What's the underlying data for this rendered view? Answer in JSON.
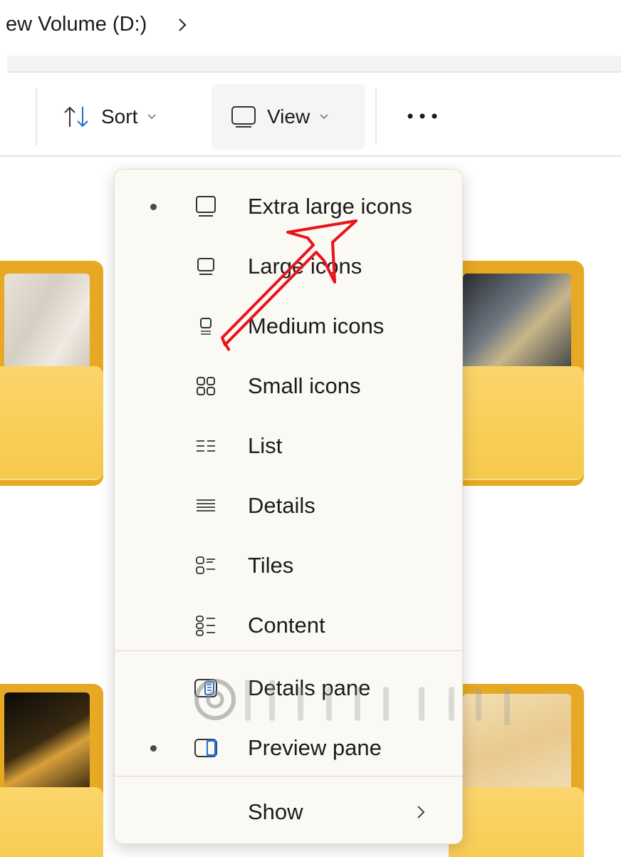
{
  "breadcrumb": {
    "current": "ew Volume (D:)"
  },
  "toolbar": {
    "sort_label": "Sort",
    "view_label": "View"
  },
  "view_menu": {
    "items": [
      {
        "label": "Extra large icons",
        "icon": "extra-large-icons-icon",
        "selected": true
      },
      {
        "label": "Large icons",
        "icon": "large-icons-icon",
        "selected": false
      },
      {
        "label": "Medium icons",
        "icon": "medium-icons-icon",
        "selected": false
      },
      {
        "label": "Small icons",
        "icon": "small-icons-icon",
        "selected": false
      },
      {
        "label": "List",
        "icon": "list-icon",
        "selected": false
      },
      {
        "label": "Details",
        "icon": "details-icon",
        "selected": false
      },
      {
        "label": "Tiles",
        "icon": "tiles-icon",
        "selected": false
      },
      {
        "label": "Content",
        "icon": "content-icon",
        "selected": false
      }
    ],
    "panes": [
      {
        "label": "Details pane",
        "icon": "details-pane-icon",
        "selected": false
      },
      {
        "label": "Preview pane",
        "icon": "preview-pane-icon",
        "selected": true
      }
    ],
    "show_label": "Show"
  },
  "colors": {
    "folder_back": "#e7a923",
    "folder_front": "#f6c94a",
    "annotation_arrow": "#e8141b",
    "menu_background": "#fbf9f3"
  }
}
